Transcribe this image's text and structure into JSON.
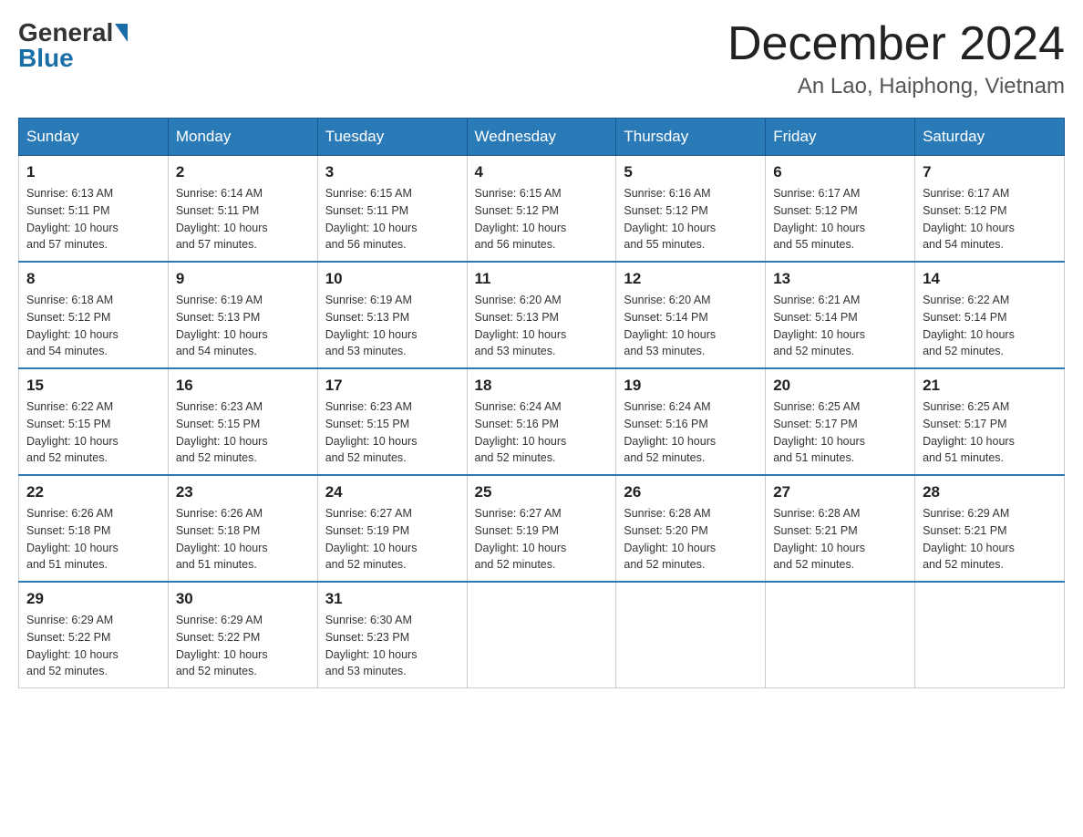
{
  "logo": {
    "general": "General",
    "blue": "Blue"
  },
  "title": "December 2024",
  "location": "An Lao, Haiphong, Vietnam",
  "headers": [
    "Sunday",
    "Monday",
    "Tuesday",
    "Wednesday",
    "Thursday",
    "Friday",
    "Saturday"
  ],
  "weeks": [
    [
      {
        "day": "1",
        "sunrise": "6:13 AM",
        "sunset": "5:11 PM",
        "daylight": "10 hours and 57 minutes."
      },
      {
        "day": "2",
        "sunrise": "6:14 AM",
        "sunset": "5:11 PM",
        "daylight": "10 hours and 57 minutes."
      },
      {
        "day": "3",
        "sunrise": "6:15 AM",
        "sunset": "5:11 PM",
        "daylight": "10 hours and 56 minutes."
      },
      {
        "day": "4",
        "sunrise": "6:15 AM",
        "sunset": "5:12 PM",
        "daylight": "10 hours and 56 minutes."
      },
      {
        "day": "5",
        "sunrise": "6:16 AM",
        "sunset": "5:12 PM",
        "daylight": "10 hours and 55 minutes."
      },
      {
        "day": "6",
        "sunrise": "6:17 AM",
        "sunset": "5:12 PM",
        "daylight": "10 hours and 55 minutes."
      },
      {
        "day": "7",
        "sunrise": "6:17 AM",
        "sunset": "5:12 PM",
        "daylight": "10 hours and 54 minutes."
      }
    ],
    [
      {
        "day": "8",
        "sunrise": "6:18 AM",
        "sunset": "5:12 PM",
        "daylight": "10 hours and 54 minutes."
      },
      {
        "day": "9",
        "sunrise": "6:19 AM",
        "sunset": "5:13 PM",
        "daylight": "10 hours and 54 minutes."
      },
      {
        "day": "10",
        "sunrise": "6:19 AM",
        "sunset": "5:13 PM",
        "daylight": "10 hours and 53 minutes."
      },
      {
        "day": "11",
        "sunrise": "6:20 AM",
        "sunset": "5:13 PM",
        "daylight": "10 hours and 53 minutes."
      },
      {
        "day": "12",
        "sunrise": "6:20 AM",
        "sunset": "5:14 PM",
        "daylight": "10 hours and 53 minutes."
      },
      {
        "day": "13",
        "sunrise": "6:21 AM",
        "sunset": "5:14 PM",
        "daylight": "10 hours and 52 minutes."
      },
      {
        "day": "14",
        "sunrise": "6:22 AM",
        "sunset": "5:14 PM",
        "daylight": "10 hours and 52 minutes."
      }
    ],
    [
      {
        "day": "15",
        "sunrise": "6:22 AM",
        "sunset": "5:15 PM",
        "daylight": "10 hours and 52 minutes."
      },
      {
        "day": "16",
        "sunrise": "6:23 AM",
        "sunset": "5:15 PM",
        "daylight": "10 hours and 52 minutes."
      },
      {
        "day": "17",
        "sunrise": "6:23 AM",
        "sunset": "5:15 PM",
        "daylight": "10 hours and 52 minutes."
      },
      {
        "day": "18",
        "sunrise": "6:24 AM",
        "sunset": "5:16 PM",
        "daylight": "10 hours and 52 minutes."
      },
      {
        "day": "19",
        "sunrise": "6:24 AM",
        "sunset": "5:16 PM",
        "daylight": "10 hours and 52 minutes."
      },
      {
        "day": "20",
        "sunrise": "6:25 AM",
        "sunset": "5:17 PM",
        "daylight": "10 hours and 51 minutes."
      },
      {
        "day": "21",
        "sunrise": "6:25 AM",
        "sunset": "5:17 PM",
        "daylight": "10 hours and 51 minutes."
      }
    ],
    [
      {
        "day": "22",
        "sunrise": "6:26 AM",
        "sunset": "5:18 PM",
        "daylight": "10 hours and 51 minutes."
      },
      {
        "day": "23",
        "sunrise": "6:26 AM",
        "sunset": "5:18 PM",
        "daylight": "10 hours and 51 minutes."
      },
      {
        "day": "24",
        "sunrise": "6:27 AM",
        "sunset": "5:19 PM",
        "daylight": "10 hours and 52 minutes."
      },
      {
        "day": "25",
        "sunrise": "6:27 AM",
        "sunset": "5:19 PM",
        "daylight": "10 hours and 52 minutes."
      },
      {
        "day": "26",
        "sunrise": "6:28 AM",
        "sunset": "5:20 PM",
        "daylight": "10 hours and 52 minutes."
      },
      {
        "day": "27",
        "sunrise": "6:28 AM",
        "sunset": "5:21 PM",
        "daylight": "10 hours and 52 minutes."
      },
      {
        "day": "28",
        "sunrise": "6:29 AM",
        "sunset": "5:21 PM",
        "daylight": "10 hours and 52 minutes."
      }
    ],
    [
      {
        "day": "29",
        "sunrise": "6:29 AM",
        "sunset": "5:22 PM",
        "daylight": "10 hours and 52 minutes."
      },
      {
        "day": "30",
        "sunrise": "6:29 AM",
        "sunset": "5:22 PM",
        "daylight": "10 hours and 52 minutes."
      },
      {
        "day": "31",
        "sunrise": "6:30 AM",
        "sunset": "5:23 PM",
        "daylight": "10 hours and 53 minutes."
      },
      null,
      null,
      null,
      null
    ]
  ],
  "labels": {
    "sunrise": "Sunrise:",
    "sunset": "Sunset:",
    "daylight": "Daylight: 10 hours"
  }
}
